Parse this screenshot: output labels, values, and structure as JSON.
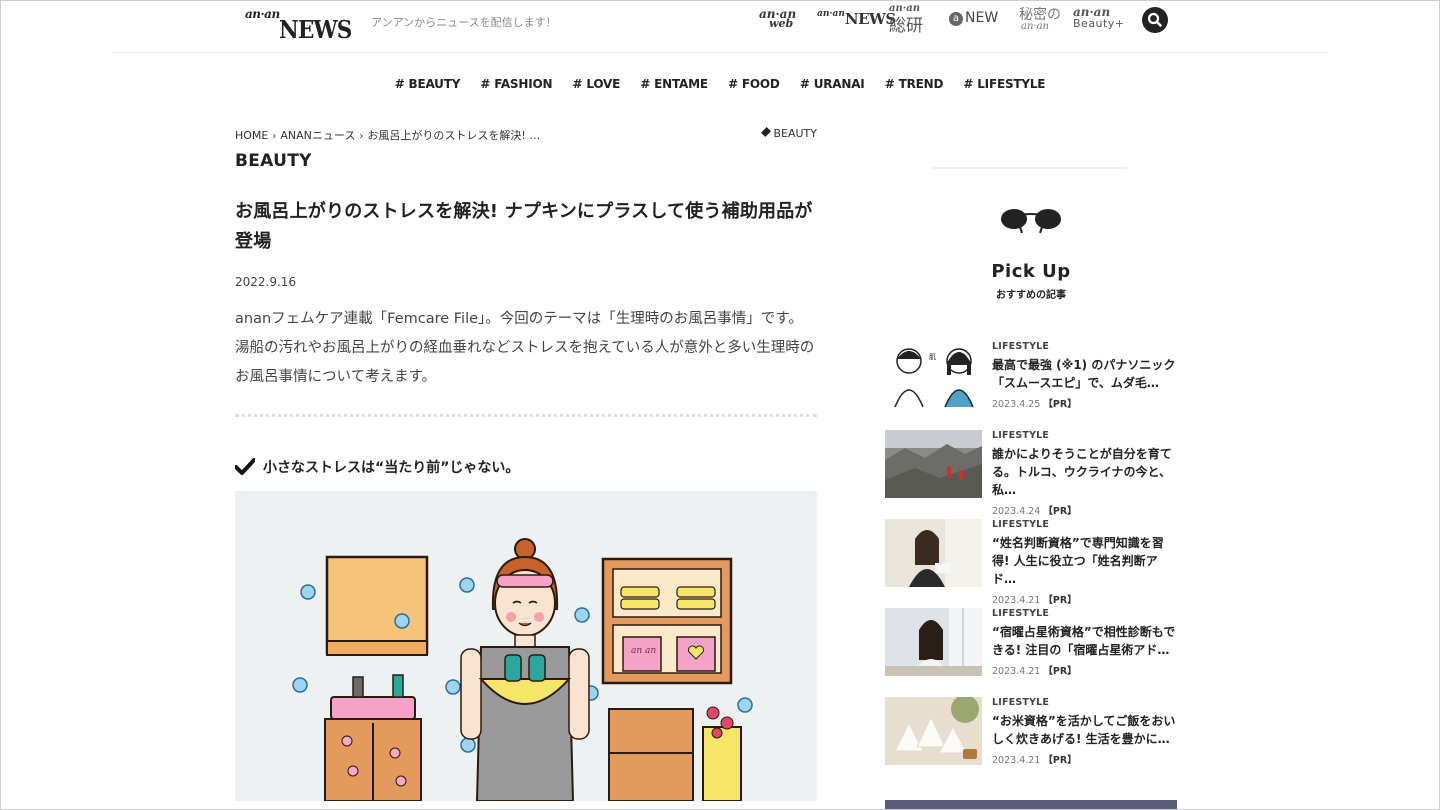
{
  "header": {
    "logo_small": "an·an",
    "logo_main": "NEWS",
    "tagline": "アンアンからニュースを配信します！",
    "sites": {
      "web_top": "an·an",
      "web_bottom": "web",
      "news_top": "an·an",
      "news_bottom": "NEWS",
      "souken_top": "an·an",
      "souken_bottom": "総研",
      "anew_mark": "a",
      "anew_text": "NEW",
      "himitsu_top": "秘密の",
      "himitsu_bottom": "an·an",
      "beauty_top": "an·an",
      "beauty_bottom": "Beauty+"
    }
  },
  "nav": {
    "items": [
      "# BEAUTY",
      "# FASHION",
      "# LOVE",
      "# ENTAME",
      "# FOOD",
      "# URANAI",
      "# TREND",
      "# LIFESTYLE"
    ]
  },
  "article": {
    "breadcrumb": {
      "home": "HOME",
      "section": "ANANニュース",
      "current": "お風呂上がりのストレスを解決! …"
    },
    "tag": "BEAUTY",
    "section": "BEAUTY",
    "title": "お風呂上がりのストレスを解決! ナプキンにプラスして使う補助用品が登場",
    "date": "2022.9.16",
    "lead": "ananフェムケア連載「Femcare File」。今回のテーマは「生理時のお風呂事情」です。湯船の汚れやお風呂上がりの経血垂れなどストレスを抱えている人が意外と多い生理時のお風呂事情について考えます。",
    "subheading": "小さなストレスは“当たり前”じゃない。",
    "illustration_text": "an an"
  },
  "sidebar": {
    "pickup_title": "Pick Up",
    "pickup_sub": "おすすめの記事",
    "items": [
      {
        "category": "LIFESTYLE",
        "title": "最高で最強 (※1) のパナソニック「スムースエピ」で、ムダ毛…",
        "date": "2023.4.25",
        "pr": "【PR】"
      },
      {
        "category": "LIFESTYLE",
        "title": "誰かによりそうことが自分を育てる。トルコ、ウクライナの今と、私…",
        "date": "2023.4.24",
        "pr": "【PR】"
      },
      {
        "category": "LIFESTYLE",
        "title": "“姓名判断資格”で専門知識を習得! 人生に役立つ「姓名判断アド…",
        "date": "2023.4.21",
        "pr": "【PR】"
      },
      {
        "category": "LIFESTYLE",
        "title": "“宿曜占星術資格”で相性診断もできる! 注目の「宿曜占星術アド…",
        "date": "2023.4.21",
        "pr": "【PR】"
      },
      {
        "category": "LIFESTYLE",
        "title": "“お米資格”を活かしてご飯をおいしく炊きあげる! 生活を豊かに…",
        "date": "2023.4.21",
        "pr": "【PR】"
      }
    ]
  },
  "colors": {
    "text": "#222222",
    "accent_dark": "#1a1a1a",
    "illus_bg": "#eef1f2"
  }
}
